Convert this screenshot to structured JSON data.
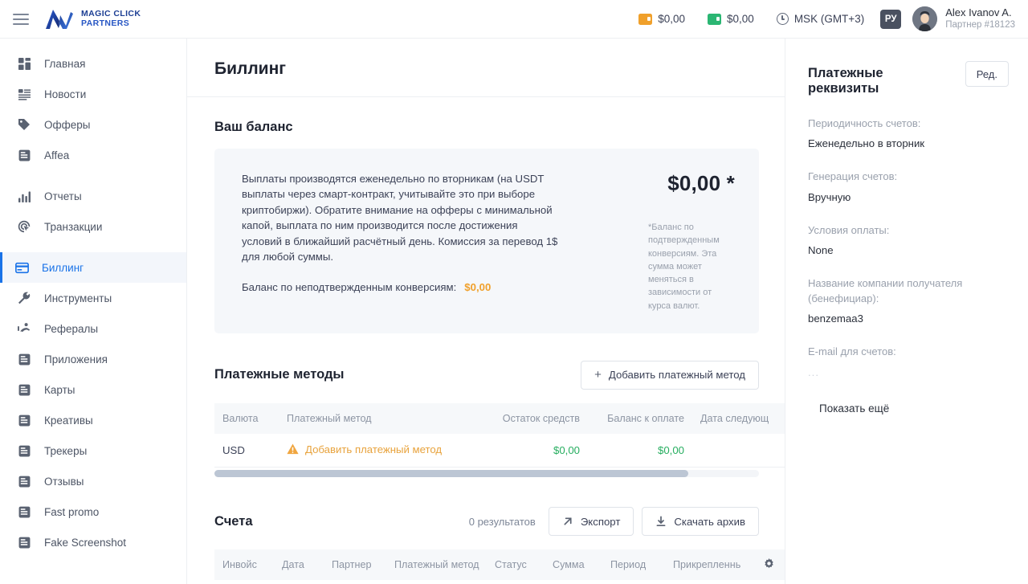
{
  "header": {
    "menu_icon": "hamburger-icon",
    "logo": {
      "line1": "MAGIC CLICK",
      "line2": "PARTNERS"
    },
    "wallet_orange": {
      "icon": "wallet-icon",
      "amount": "$0,00",
      "color": "#f0a02b"
    },
    "wallet_green": {
      "icon": "wallet-icon",
      "amount": "$0,00",
      "color": "#2bb673"
    },
    "timezone": {
      "icon": "clock-icon",
      "label": "MSK (GMT+3)"
    },
    "language": "РУ",
    "user": {
      "avatar": "avatar",
      "name": "Alex Ivanov A.",
      "subtitle": "Партнер #18123"
    }
  },
  "sidebar": {
    "items": [
      {
        "label": "Главная",
        "icon": "dashboard-icon",
        "active": false
      },
      {
        "label": "Новости",
        "icon": "news-icon",
        "active": false
      },
      {
        "label": "Офферы",
        "icon": "tag-icon",
        "active": false
      },
      {
        "label": "Affea",
        "icon": "document-icon",
        "active": false
      },
      {
        "label": "Отчеты",
        "icon": "bar-chart-icon",
        "active": false
      },
      {
        "label": "Транзакции",
        "icon": "cursor-target-icon",
        "active": false
      },
      {
        "label": "Биллинг",
        "icon": "credit-card-icon",
        "active": true
      },
      {
        "label": "Инструменты",
        "icon": "wrench-icon",
        "active": false
      },
      {
        "label": "Рефералы",
        "icon": "referral-icon",
        "active": false
      },
      {
        "label": "Приложения",
        "icon": "document-icon",
        "active": false
      },
      {
        "label": "Карты",
        "icon": "document-icon",
        "active": false
      },
      {
        "label": "Креативы",
        "icon": "document-icon",
        "active": false
      },
      {
        "label": "Трекеры",
        "icon": "document-icon",
        "active": false
      },
      {
        "label": "Отзывы",
        "icon": "document-icon",
        "active": false
      },
      {
        "label": "Fast promo",
        "icon": "document-icon",
        "active": false
      },
      {
        "label": "Fake Screenshot",
        "icon": "document-icon",
        "active": false
      }
    ]
  },
  "page": {
    "title": "Биллинг"
  },
  "balance": {
    "section_title": "Ваш баланс",
    "description": "Выплаты производятся еженедельно по вторникам (на USDT выплаты через смарт-контракт, учитывайте это при выборе криптобиржи). Обратите внимание на офферы с минимальной капой, выплата по ним производится после достижения условий в ближайший расчётный день. Комиссия за перевод 1$ для любой суммы.",
    "unconfirmed_label": "Баланс по неподтвержденным конверсиям:",
    "unconfirmed_value": "$0,00",
    "amount": "$0,00 *",
    "footnote": "*Баланс по подтвержденным конверсиям. Эта сумма может меняться в зависимости от курса валют."
  },
  "payment_methods": {
    "section_title": "Платежные методы",
    "add_button": "Добавить платежный метод",
    "columns": [
      "Валюта",
      "Платежный метод",
      "Остаток средств",
      "Баланс к оплате",
      "Дата следующ"
    ],
    "rows": [
      {
        "currency": "USD",
        "method": "Добавить платежный метод",
        "method_icon": "warning-triangle-icon",
        "balance_left": "$0,00",
        "balance_due": "$0,00",
        "next_date": ""
      }
    ]
  },
  "invoices": {
    "section_title": "Счета",
    "results": "0  результатов",
    "export_button": "Экспорт",
    "export_icon": "arrow-up-right-icon",
    "archive_button": "Скачать архив",
    "archive_icon": "download-icon",
    "settings_icon": "gear-icon",
    "columns": [
      "Инвойс",
      "Дата",
      "Партнер",
      "Платежный метод",
      "Статус",
      "Сумма",
      "Период",
      "Прикрепленнь"
    ]
  },
  "requisites": {
    "title": "Платежные реквизиты",
    "edit_button": "Ред.",
    "fields": [
      {
        "label": "Периодичность счетов:",
        "value": "Еженедельно в вторник",
        "muted": false
      },
      {
        "label": "Генерация счетов:",
        "value": "Вручную",
        "muted": false
      },
      {
        "label": "Условия оплаты:",
        "value": "None",
        "muted": false
      },
      {
        "label": "Название компании получателя (бенефициар):",
        "value": "benzemaa3",
        "muted": false
      },
      {
        "label": "E-mail для счетов:",
        "value": "...",
        "muted": true
      }
    ],
    "show_more": "Показать ещё"
  },
  "colors": {
    "accent": "#1a73e8",
    "warning": "#e8a33d",
    "success": "#27ae60",
    "brand": "#1d3f94"
  }
}
